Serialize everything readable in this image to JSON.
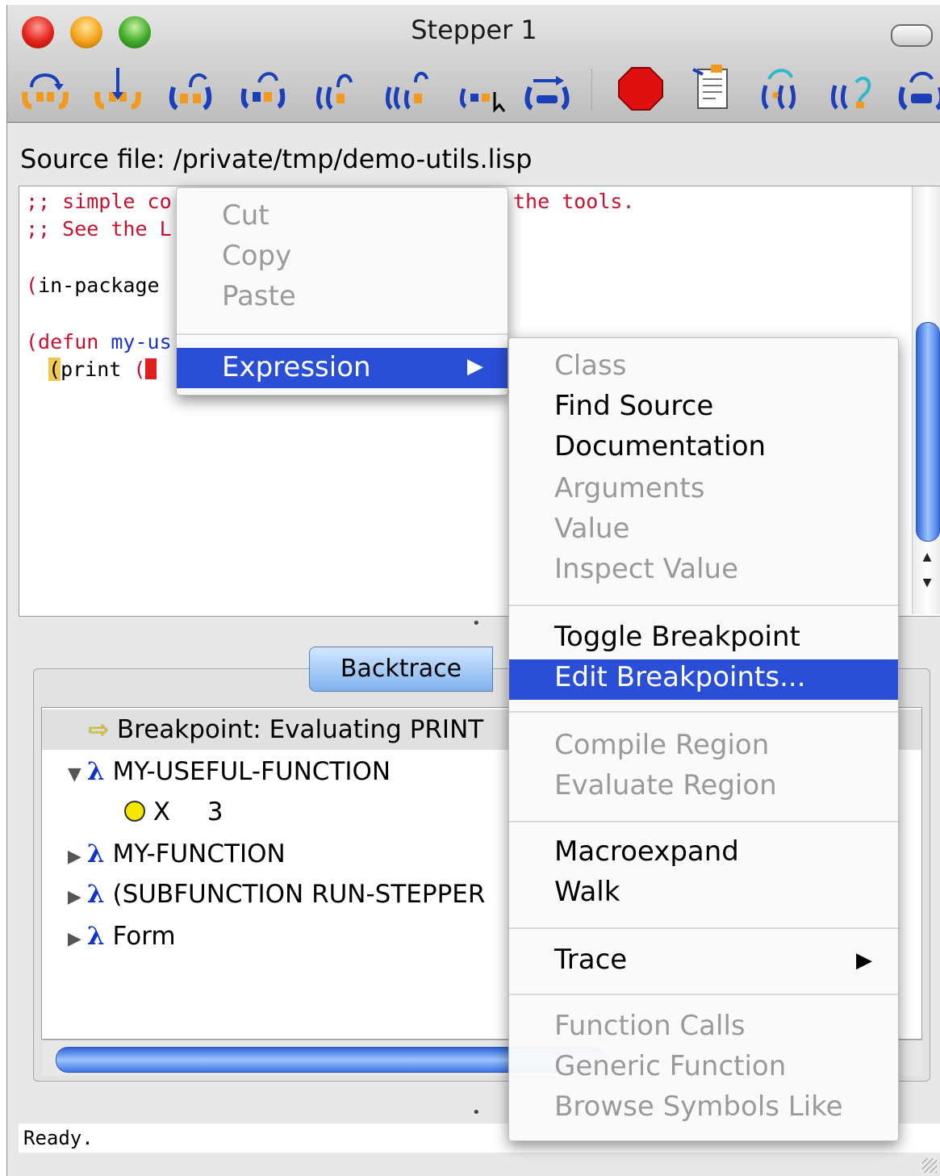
{
  "window": {
    "title": "Stepper 1"
  },
  "toolbar": {
    "buttons": [
      {
        "icon": "step-over-icon"
      },
      {
        "icon": "step-into-icon"
      },
      {
        "icon": "step-out-icon"
      },
      {
        "icon": "step-next-icon"
      },
      {
        "icon": "step-through-call-icon"
      },
      {
        "icon": "step-nested-call-icon"
      },
      {
        "icon": "step-to-cursor-icon"
      },
      {
        "icon": "step-continue-icon"
      },
      {
        "icon": "stop-sign-icon"
      },
      {
        "icon": "source-document-icon"
      },
      {
        "icon": "restart-frame-icon"
      },
      {
        "icon": "undo-macroexpand-icon"
      },
      {
        "icon": "show-value-icon"
      }
    ]
  },
  "source": {
    "label": "Source file: /private/tmp/demo-utils.lisp",
    "lines": {
      "l1a": ";; simple co",
      "l1b": "the tools.",
      "l2": ";; See the L",
      "l3a": "(",
      "l3b": "in-package",
      "l4a": "(defun ",
      "l4b": "my-us",
      "l5a": "(",
      "l5b": "print ",
      "l5c": "("
    }
  },
  "tabs": {
    "backtrace": "Backtrace"
  },
  "backtrace": {
    "rows": [
      {
        "text": "Breakpoint: Evaluating PRINT"
      },
      {
        "text": "MY-USEFUL-FUNCTION",
        "lambda": "λ"
      },
      {
        "var": "X",
        "value": "3"
      },
      {
        "text": "MY-FUNCTION",
        "lambda": "λ"
      },
      {
        "text": "(SUBFUNCTION RUN-STEPPER",
        "lambda": "λ"
      },
      {
        "text": "Form",
        "lambda": "λ"
      }
    ]
  },
  "status": {
    "text": "Ready."
  },
  "context_menu": {
    "items": {
      "cut": "Cut",
      "copy": "Copy",
      "paste": "Paste",
      "expression": "Expression"
    }
  },
  "expression_menu": {
    "class": "Class",
    "find_source": "Find Source",
    "documentation": "Documentation",
    "arguments": "Arguments",
    "value": "Value",
    "inspect_value": "Inspect Value",
    "toggle_breakpoint": "Toggle Breakpoint",
    "edit_breakpoints": "Edit Breakpoints...",
    "compile_region": "Compile Region",
    "evaluate_region": "Evaluate Region",
    "macroexpand": "Macroexpand",
    "walk": "Walk",
    "trace": "Trace",
    "function_calls": "Function Calls",
    "generic_function": "Generic Function",
    "browse_symbols_like": "Browse Symbols Like"
  },
  "colors": {
    "highlight": "#2a4fd6",
    "comment": "#c8102e",
    "keyword": "#1a33cc",
    "scroll_thumb": "#3f74e6"
  }
}
